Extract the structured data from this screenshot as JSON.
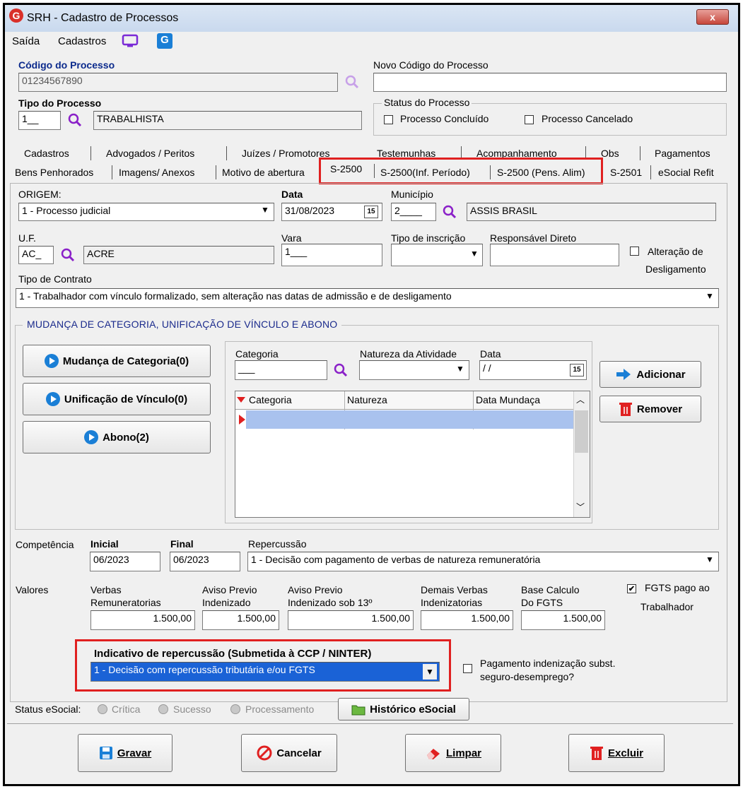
{
  "window": {
    "title": "SRH - Cadastro de Processos",
    "close": "x"
  },
  "menu": {
    "saida": "Saída",
    "cadastros": "Cadastros"
  },
  "header": {
    "codigo_label": "Código do Processo",
    "codigo_value": "01234567890",
    "novo_codigo_label": "Novo Código do Processo",
    "novo_codigo_value": "",
    "tipo_label": "Tipo do Processo",
    "tipo_code": "1__",
    "tipo_desc": "TRABALHISTA",
    "status_group": "Status do Processo",
    "status_concluido": "Processo Concluído",
    "status_cancelado": "Processo Cancelado"
  },
  "tabs_row1": [
    "Cadastros",
    "Advogados / Peritos",
    "Juízes / Promotores",
    "Testemunhas",
    "Acompanhamento",
    "Obs",
    "Pagamentos"
  ],
  "tabs_row2": [
    "Bens Penhorados",
    "Imagens/ Anexos",
    "Motivo de abertura",
    "S-2500",
    "S-2500(Inf. Período)",
    "S-2500 (Pens. Alim)",
    "S-2501",
    "eSocial Refit"
  ],
  "form": {
    "origem_label": "ORIGEM:",
    "origem_value": "1 - Processo judicial",
    "data_label": "Data",
    "data_value": "31/08/2023",
    "municipio_label": "Município",
    "municipio_code": "2____",
    "municipio_desc": "ASSIS BRASIL",
    "uf_label": "U.F.",
    "uf_code": "AC_",
    "uf_desc": "ACRE",
    "vara_label": "Vara",
    "vara_value": "1___",
    "tipo_inscricao_label": "Tipo de inscrição",
    "responsavel_label": "Responsável Direto",
    "alteracao_label1": "Alteração de",
    "alteracao_label2": "Desligamento",
    "tipo_contrato_label": "Tipo de Contrato",
    "tipo_contrato_value": "1 - Trabalhador com vínculo formalizado, sem alteração nas datas de admissão e de desligamento"
  },
  "mudanca": {
    "group_title": "MUDANÇA DE CATEGORIA, UNIFICAÇÃO DE VÍNCULO E ABONO",
    "btn_mudanca": "Mudança de Categoria(0)",
    "btn_unificacao": "Unificação de Vínculo(0)",
    "btn_abono": "Abono(2)",
    "categoria_label": "Categoria",
    "categoria_value": "___",
    "natureza_label": "Natureza da Atividade",
    "data_label": "Data",
    "data_value": " / /",
    "adicionar": "Adicionar",
    "remover": "Remover",
    "grid_headers": [
      "Categoria",
      "Natureza",
      "Data Mundaça"
    ]
  },
  "competencia": {
    "label": "Competência",
    "inicial_label": "Inicial",
    "inicial_value": "06/2023",
    "final_label": "Final",
    "final_value": "06/2023",
    "repercussao_label": "Repercussão",
    "repercussao_value": "1 - Decisão com pagamento de verbas de natureza remuneratória"
  },
  "valores": {
    "label": "Valores",
    "verbas_l1": "Verbas",
    "verbas_l2": "Remuneratorias",
    "verbas_value": "1.500,00",
    "aviso_l1": "Aviso Previo",
    "aviso_l2": "Indenizado",
    "aviso_value": "1.500,00",
    "aviso13_l1": "Aviso Previo",
    "aviso13_l2": "Indenizado sob 13º",
    "aviso13_value": "1.500,00",
    "demais_l1": "Demais Verbas",
    "demais_l2": "Indenizatorias",
    "demais_value": "1.500,00",
    "base_l1": "Base Calculo",
    "base_l2": "Do FGTS",
    "base_value": "1.500,00",
    "fgts_l1": "FGTS pago ao",
    "fgts_l2": "Trabalhador"
  },
  "indicativo": {
    "label": "Indicativo de repercussão (Submetida à CCP / NINTER)",
    "value": "1 - Decisão com repercussão tributária e/ou FGTS",
    "pagamento_l1": "Pagamento indenização subst.",
    "pagamento_l2": "seguro-desemprego?"
  },
  "status_esocial": {
    "label": "Status eSocial:",
    "critica": "Crítica",
    "sucesso": "Sucesso",
    "processamento": "Processamento",
    "historico": "Histórico eSocial"
  },
  "footer": {
    "gravar": "Gravar",
    "cancelar": "Cancelar",
    "limpar": "Limpar",
    "excluir": "Excluir"
  },
  "colors": {
    "accent": "#1a62d6",
    "highlight": "#e02020",
    "title_blue": "#0b2a8c"
  }
}
